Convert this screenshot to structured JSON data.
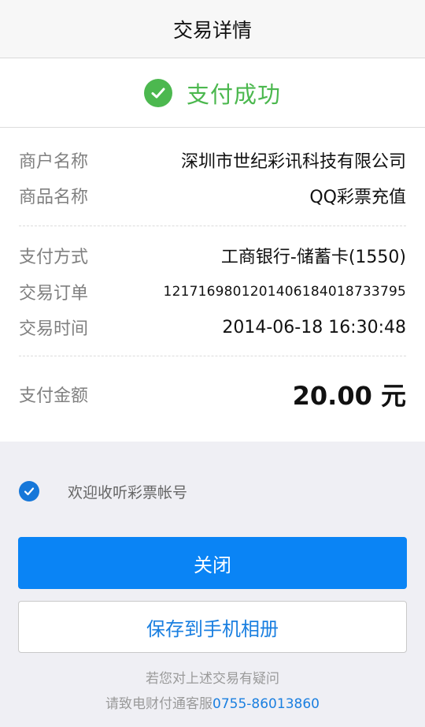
{
  "header": {
    "title": "交易详情"
  },
  "status": {
    "text": "支付成功",
    "color": "#4cb84f"
  },
  "details": {
    "merchant_label": "商户名称",
    "merchant_value": "深圳市世纪彩讯科技有限公司",
    "product_label": "商品名称",
    "product_value": "QQ彩票充值",
    "method_label": "支付方式",
    "method_value": "工商银行-储蓄卡(1550)",
    "order_label": "交易订单",
    "order_value": "1217169801201406184018733795",
    "time_label": "交易时间",
    "time_value": "2014-06-18 16:30:48",
    "amount_label": "支付金额",
    "amount_value": "20.00 元"
  },
  "agreement": {
    "label": "欢迎收听彩票帐号",
    "checked": true
  },
  "buttons": {
    "close_label": "关闭",
    "save_label": "保存到手机相册"
  },
  "footer": {
    "line1": "若您对上述交易有疑问",
    "line2_prefix": "请致电财付通客服",
    "phone": "0755-86013860"
  },
  "colors": {
    "primary": "#0a84f5",
    "success": "#4cb84f",
    "link": "#1a7fe0"
  }
}
